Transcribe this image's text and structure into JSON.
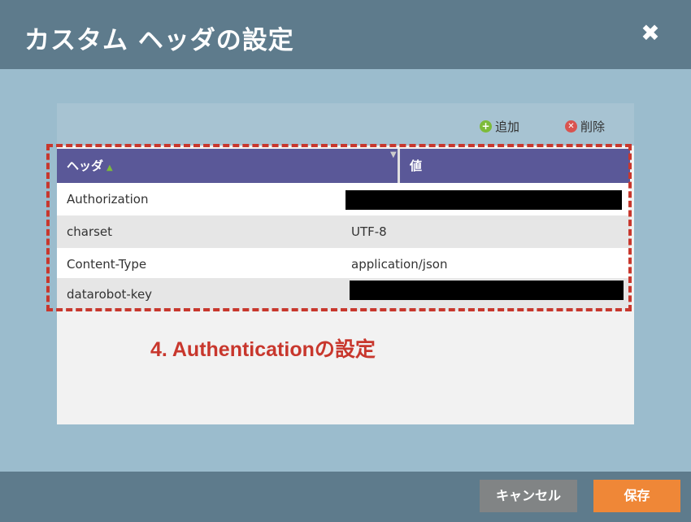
{
  "dialog": {
    "title": "カスタム ヘッダの設定",
    "close_label": "✖"
  },
  "toolbar": {
    "add_label": "追加",
    "delete_label": "削除"
  },
  "table": {
    "columns": [
      "ヘッダ",
      "値"
    ],
    "rows": [
      {
        "header": "Authorization",
        "value": ""
      },
      {
        "header": "charset",
        "value": "UTF-8"
      },
      {
        "header": "Content-Type",
        "value": "application/json"
      },
      {
        "header": "datarobot-key",
        "value": ""
      }
    ]
  },
  "annotation": {
    "text": "4. Authenticationの設定",
    "color": "#c8372d"
  },
  "footer": {
    "cancel_label": "キャンセル",
    "save_label": "保存"
  },
  "colors": {
    "header_bg": "#5a5898",
    "save": "#ef8737",
    "cancel": "#818485"
  }
}
